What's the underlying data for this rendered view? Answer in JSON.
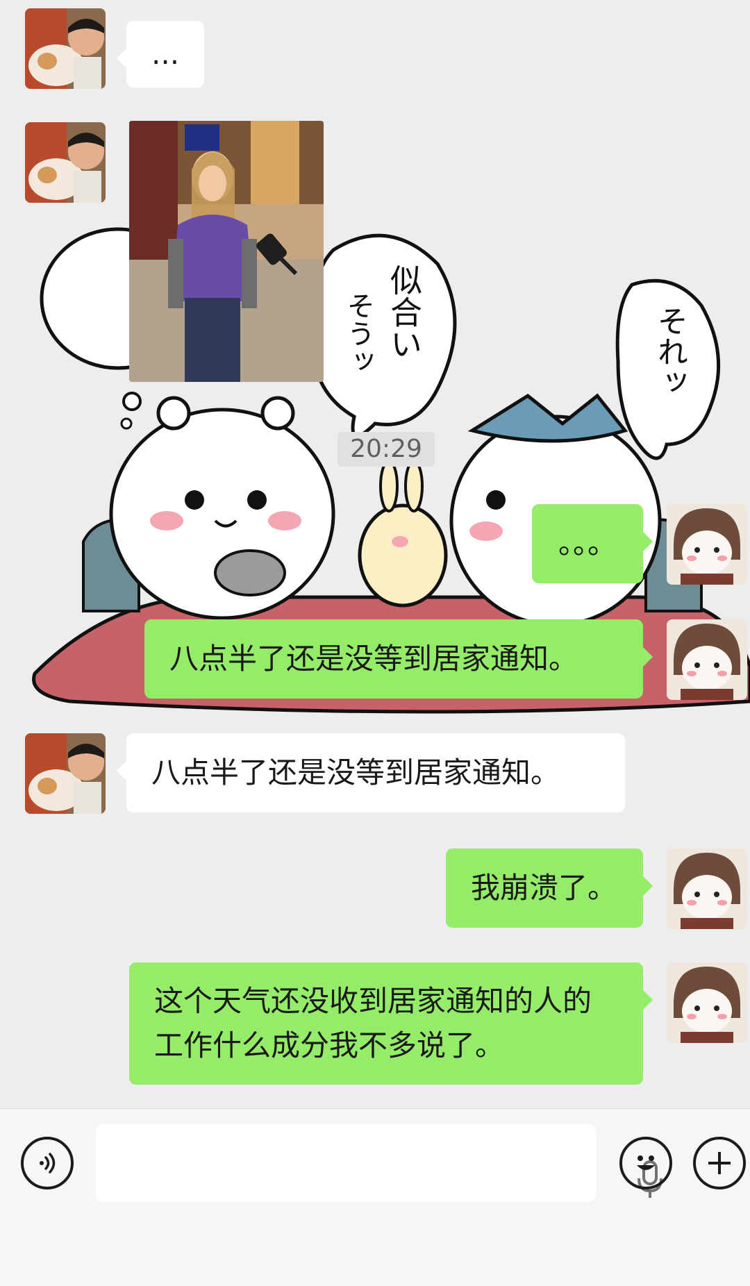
{
  "chat": {
    "messages": [
      {
        "side": "received",
        "type": "text",
        "text": "..."
      },
      {
        "side": "received",
        "type": "image"
      },
      {
        "side": "received",
        "type": "sticker"
      },
      {
        "side": "sent",
        "type": "text",
        "text": "。。。"
      },
      {
        "side": "sent",
        "type": "text",
        "text": "八点半了还是没等到居家通知。"
      },
      {
        "side": "received",
        "type": "text",
        "text": "八点半了还是没等到居家通知。"
      },
      {
        "side": "sent",
        "type": "text",
        "text": "我崩溃了。"
      },
      {
        "side": "sent",
        "type": "text",
        "text": "这个天气还没收到居家通知的人的工作什么成分我不多说了。"
      }
    ],
    "timestamp": "20:29",
    "sticker_text": {
      "bubble_left_line1": "似合い",
      "bubble_left_line2": "そうッ",
      "bubble_right": "それッ"
    }
  },
  "input_bar": {
    "icons": [
      "voice-icon",
      "microphone-icon",
      "emoji-icon",
      "plus-icon"
    ]
  },
  "colors": {
    "sent_bubble": "#95ec69",
    "received_bubble": "#ffffff",
    "background": "#ededed"
  }
}
